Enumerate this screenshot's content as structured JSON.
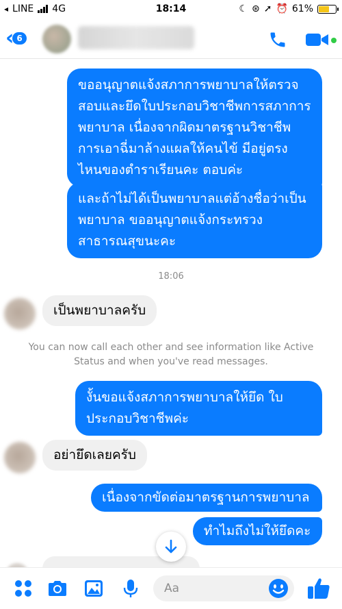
{
  "status_bar": {
    "carrier": "LINE",
    "network": "4G",
    "time": "18:14",
    "battery_percent": "61%",
    "battery_level": 0.61
  },
  "header": {
    "back_count": "6",
    "accent_color": "#0a7cff"
  },
  "messages": [
    {
      "direction": "out",
      "text": "ขออนุญาตแจ้งสภาการพยาบาลให้ตรวจสอบและยึดใบประกอบวิชาชีพการสภาการพยาบาล เนื่องจากผิดมาตรฐานวิชาชีพ การเอาฉี่มาล้างแผลให้คนไข้ มีอยู่ตรงไหนของตำราเรียนคะ ตอบค่ะ"
    },
    {
      "direction": "out",
      "text": "และถ้าไม่ได้เป็นพยาบาลแต่อ้างชื่อว่าเป็นพยาบาล ขออนุญาตแจ้งกระทรวงสาธารณสุขนะคะ"
    },
    {
      "direction": "in",
      "text": "เป็นพยาบาลครับ"
    },
    {
      "direction": "out",
      "text": "งั้นขอแจ้งสภาการพยาบาลให้ยึด ใบประกอบวิชาชีพค่ะ"
    },
    {
      "direction": "in",
      "text": "อย่ายึดเลยครับ"
    },
    {
      "direction": "out",
      "text": "เนื่องจากขัดต่อมาตรฐานการพยาบาล"
    },
    {
      "direction": "out",
      "text": "ทำไมถึงไม่ให้ยึดคะ"
    }
  ],
  "timestamp": "18:06",
  "info_notice": "You can now call each other and see information like Active Status and when you've read messages.",
  "composer": {
    "placeholder": "Aa",
    "icons": [
      "apps-icon",
      "camera-icon",
      "gallery-icon",
      "microphone-icon",
      "emoji-icon",
      "like-icon"
    ]
  }
}
